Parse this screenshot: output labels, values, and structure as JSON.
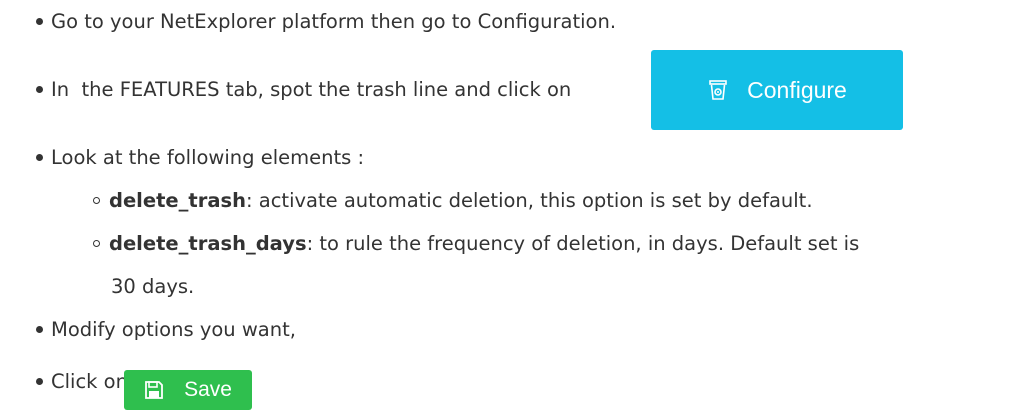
{
  "colors": {
    "text": "#333333",
    "configure_button_bg": "#14bfe6",
    "save_button_bg": "#2fbf4e",
    "button_text": "#ffffff"
  },
  "steps": [
    {
      "text": "Go to your NetExplorer platform then go to Configuration."
    },
    {
      "text": "In  the FEATURES tab, spot the trash line and click on"
    },
    {
      "text": "Look at the following elements :"
    },
    {
      "text": "Modify options you want,"
    },
    {
      "text": "Click on"
    }
  ],
  "sub_items": [
    {
      "term": "delete_trash",
      "description": ": activate automatic deletion, this option is set by default."
    },
    {
      "term": "delete_trash_days",
      "description": ": to rule the frequency of deletion, in days. Default set is",
      "continuation": "30 days."
    }
  ],
  "buttons": {
    "configure": {
      "label": "Configure",
      "icon": "trash-gear-icon"
    },
    "save": {
      "label": "Save",
      "icon": "floppy-disk-icon"
    }
  }
}
